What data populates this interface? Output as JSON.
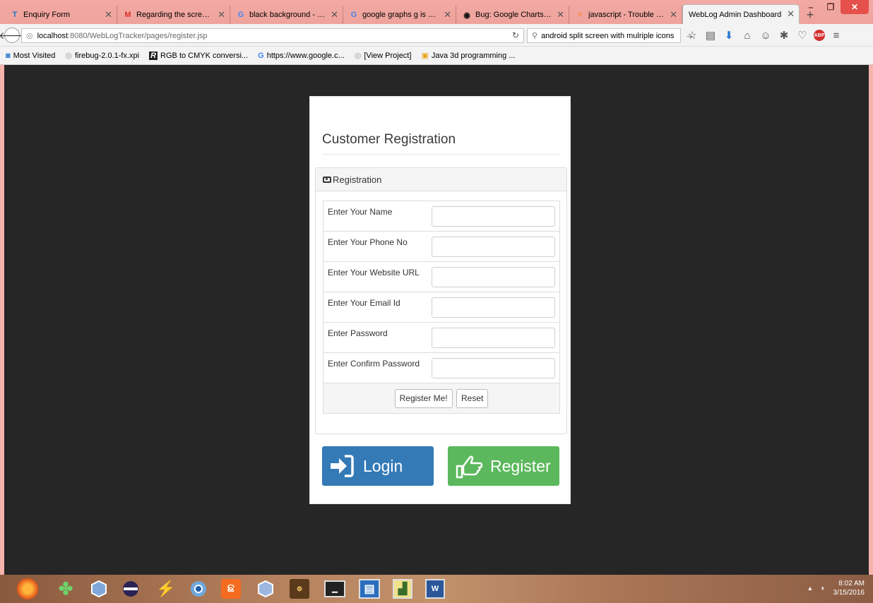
{
  "browser": {
    "tabs": [
      {
        "title": "Enquiry Form",
        "icon": "T",
        "color": "#1a7bc9",
        "active": false
      },
      {
        "title": "Regarding the screensh...",
        "icon": "M",
        "color": "#d93025",
        "active": false
      },
      {
        "title": "black background - Goo...",
        "icon": "G",
        "color": "#4285f4",
        "active": false
      },
      {
        "title": "google graphs g is unde...",
        "icon": "G",
        "color": "#4285f4",
        "active": false
      },
      {
        "title": "Bug: Google Charts will ...",
        "icon": "◉",
        "color": "#111111",
        "active": false
      },
      {
        "title": "javascript - Trouble with...",
        "icon": "≡",
        "color": "#f48024",
        "active": false
      },
      {
        "title": "WebLog Admin Dashboard",
        "icon": "",
        "color": "#000000",
        "active": true
      }
    ],
    "url_host": "localhost",
    "url_path": ":8080/WebLogTracker/pages/register.jsp",
    "search_text": "android split screen with mulriple icons",
    "bookmarks": [
      {
        "label": "Most Visited",
        "icon": "◙"
      },
      {
        "label": "firebug-2.0.1-fx.xpi",
        "icon": "◎"
      },
      {
        "label": "RGB to CMYK conversi...",
        "icon": "R"
      },
      {
        "label": "https://www.google.c...",
        "icon": "G"
      },
      {
        "label": "[View Project]",
        "icon": "◎"
      },
      {
        "label": "Java 3d programming ...",
        "icon": "▣"
      }
    ]
  },
  "page": {
    "title": "Customer Registration",
    "panel_heading": "Registration",
    "fields": [
      {
        "label": "Enter Your Name",
        "value": ""
      },
      {
        "label": "Enter Your Phone No",
        "value": ""
      },
      {
        "label": "Enter Your Website URL",
        "value": ""
      },
      {
        "label": "Enter Your Email Id",
        "value": ""
      },
      {
        "label": "Enter Password",
        "value": ""
      },
      {
        "label": "Enter Confirm Password",
        "value": ""
      }
    ],
    "submit_label": "Register Me!",
    "reset_label": "Reset",
    "login_label": "Login",
    "register_label": "Register",
    "colors": {
      "login": "#337ab7",
      "register": "#5cb85c",
      "page_bg": "#262626"
    }
  },
  "taskbar": {
    "apps": [
      "firefox-icon",
      "clover-icon",
      "virtualbox-icon",
      "eclipse-icon",
      "flash-icon",
      "chrome-icon",
      "xampp-icon",
      "virtualbox-icon-2",
      "javaee-ide-icon",
      "cmd-icon",
      "remote-desktop-icon",
      "project-icon",
      "word-icon"
    ],
    "time": "8:02 AM",
    "date": "3/15/2016"
  }
}
